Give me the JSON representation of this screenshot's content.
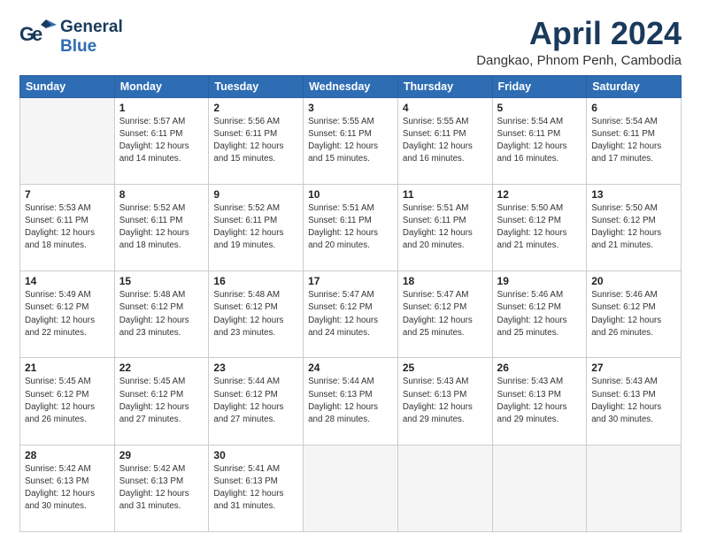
{
  "logo": {
    "line1": "General",
    "line2": "Blue"
  },
  "title": "April 2024",
  "location": "Dangkao, Phnom Penh, Cambodia",
  "days_of_week": [
    "Sunday",
    "Monday",
    "Tuesday",
    "Wednesday",
    "Thursday",
    "Friday",
    "Saturday"
  ],
  "weeks": [
    [
      {
        "day": "",
        "info": ""
      },
      {
        "day": "1",
        "info": "Sunrise: 5:57 AM\nSunset: 6:11 PM\nDaylight: 12 hours\nand 14 minutes."
      },
      {
        "day": "2",
        "info": "Sunrise: 5:56 AM\nSunset: 6:11 PM\nDaylight: 12 hours\nand 15 minutes."
      },
      {
        "day": "3",
        "info": "Sunrise: 5:55 AM\nSunset: 6:11 PM\nDaylight: 12 hours\nand 15 minutes."
      },
      {
        "day": "4",
        "info": "Sunrise: 5:55 AM\nSunset: 6:11 PM\nDaylight: 12 hours\nand 16 minutes."
      },
      {
        "day": "5",
        "info": "Sunrise: 5:54 AM\nSunset: 6:11 PM\nDaylight: 12 hours\nand 16 minutes."
      },
      {
        "day": "6",
        "info": "Sunrise: 5:54 AM\nSunset: 6:11 PM\nDaylight: 12 hours\nand 17 minutes."
      }
    ],
    [
      {
        "day": "7",
        "info": "Sunrise: 5:53 AM\nSunset: 6:11 PM\nDaylight: 12 hours\nand 18 minutes."
      },
      {
        "day": "8",
        "info": "Sunrise: 5:52 AM\nSunset: 6:11 PM\nDaylight: 12 hours\nand 18 minutes."
      },
      {
        "day": "9",
        "info": "Sunrise: 5:52 AM\nSunset: 6:11 PM\nDaylight: 12 hours\nand 19 minutes."
      },
      {
        "day": "10",
        "info": "Sunrise: 5:51 AM\nSunset: 6:11 PM\nDaylight: 12 hours\nand 20 minutes."
      },
      {
        "day": "11",
        "info": "Sunrise: 5:51 AM\nSunset: 6:11 PM\nDaylight: 12 hours\nand 20 minutes."
      },
      {
        "day": "12",
        "info": "Sunrise: 5:50 AM\nSunset: 6:12 PM\nDaylight: 12 hours\nand 21 minutes."
      },
      {
        "day": "13",
        "info": "Sunrise: 5:50 AM\nSunset: 6:12 PM\nDaylight: 12 hours\nand 21 minutes."
      }
    ],
    [
      {
        "day": "14",
        "info": "Sunrise: 5:49 AM\nSunset: 6:12 PM\nDaylight: 12 hours\nand 22 minutes."
      },
      {
        "day": "15",
        "info": "Sunrise: 5:48 AM\nSunset: 6:12 PM\nDaylight: 12 hours\nand 23 minutes."
      },
      {
        "day": "16",
        "info": "Sunrise: 5:48 AM\nSunset: 6:12 PM\nDaylight: 12 hours\nand 23 minutes."
      },
      {
        "day": "17",
        "info": "Sunrise: 5:47 AM\nSunset: 6:12 PM\nDaylight: 12 hours\nand 24 minutes."
      },
      {
        "day": "18",
        "info": "Sunrise: 5:47 AM\nSunset: 6:12 PM\nDaylight: 12 hours\nand 25 minutes."
      },
      {
        "day": "19",
        "info": "Sunrise: 5:46 AM\nSunset: 6:12 PM\nDaylight: 12 hours\nand 25 minutes."
      },
      {
        "day": "20",
        "info": "Sunrise: 5:46 AM\nSunset: 6:12 PM\nDaylight: 12 hours\nand 26 minutes."
      }
    ],
    [
      {
        "day": "21",
        "info": "Sunrise: 5:45 AM\nSunset: 6:12 PM\nDaylight: 12 hours\nand 26 minutes."
      },
      {
        "day": "22",
        "info": "Sunrise: 5:45 AM\nSunset: 6:12 PM\nDaylight: 12 hours\nand 27 minutes."
      },
      {
        "day": "23",
        "info": "Sunrise: 5:44 AM\nSunset: 6:12 PM\nDaylight: 12 hours\nand 27 minutes."
      },
      {
        "day": "24",
        "info": "Sunrise: 5:44 AM\nSunset: 6:13 PM\nDaylight: 12 hours\nand 28 minutes."
      },
      {
        "day": "25",
        "info": "Sunrise: 5:43 AM\nSunset: 6:13 PM\nDaylight: 12 hours\nand 29 minutes."
      },
      {
        "day": "26",
        "info": "Sunrise: 5:43 AM\nSunset: 6:13 PM\nDaylight: 12 hours\nand 29 minutes."
      },
      {
        "day": "27",
        "info": "Sunrise: 5:43 AM\nSunset: 6:13 PM\nDaylight: 12 hours\nand 30 minutes."
      }
    ],
    [
      {
        "day": "28",
        "info": "Sunrise: 5:42 AM\nSunset: 6:13 PM\nDaylight: 12 hours\nand 30 minutes."
      },
      {
        "day": "29",
        "info": "Sunrise: 5:42 AM\nSunset: 6:13 PM\nDaylight: 12 hours\nand 31 minutes."
      },
      {
        "day": "30",
        "info": "Sunrise: 5:41 AM\nSunset: 6:13 PM\nDaylight: 12 hours\nand 31 minutes."
      },
      {
        "day": "",
        "info": ""
      },
      {
        "day": "",
        "info": ""
      },
      {
        "day": "",
        "info": ""
      },
      {
        "day": "",
        "info": ""
      }
    ]
  ]
}
